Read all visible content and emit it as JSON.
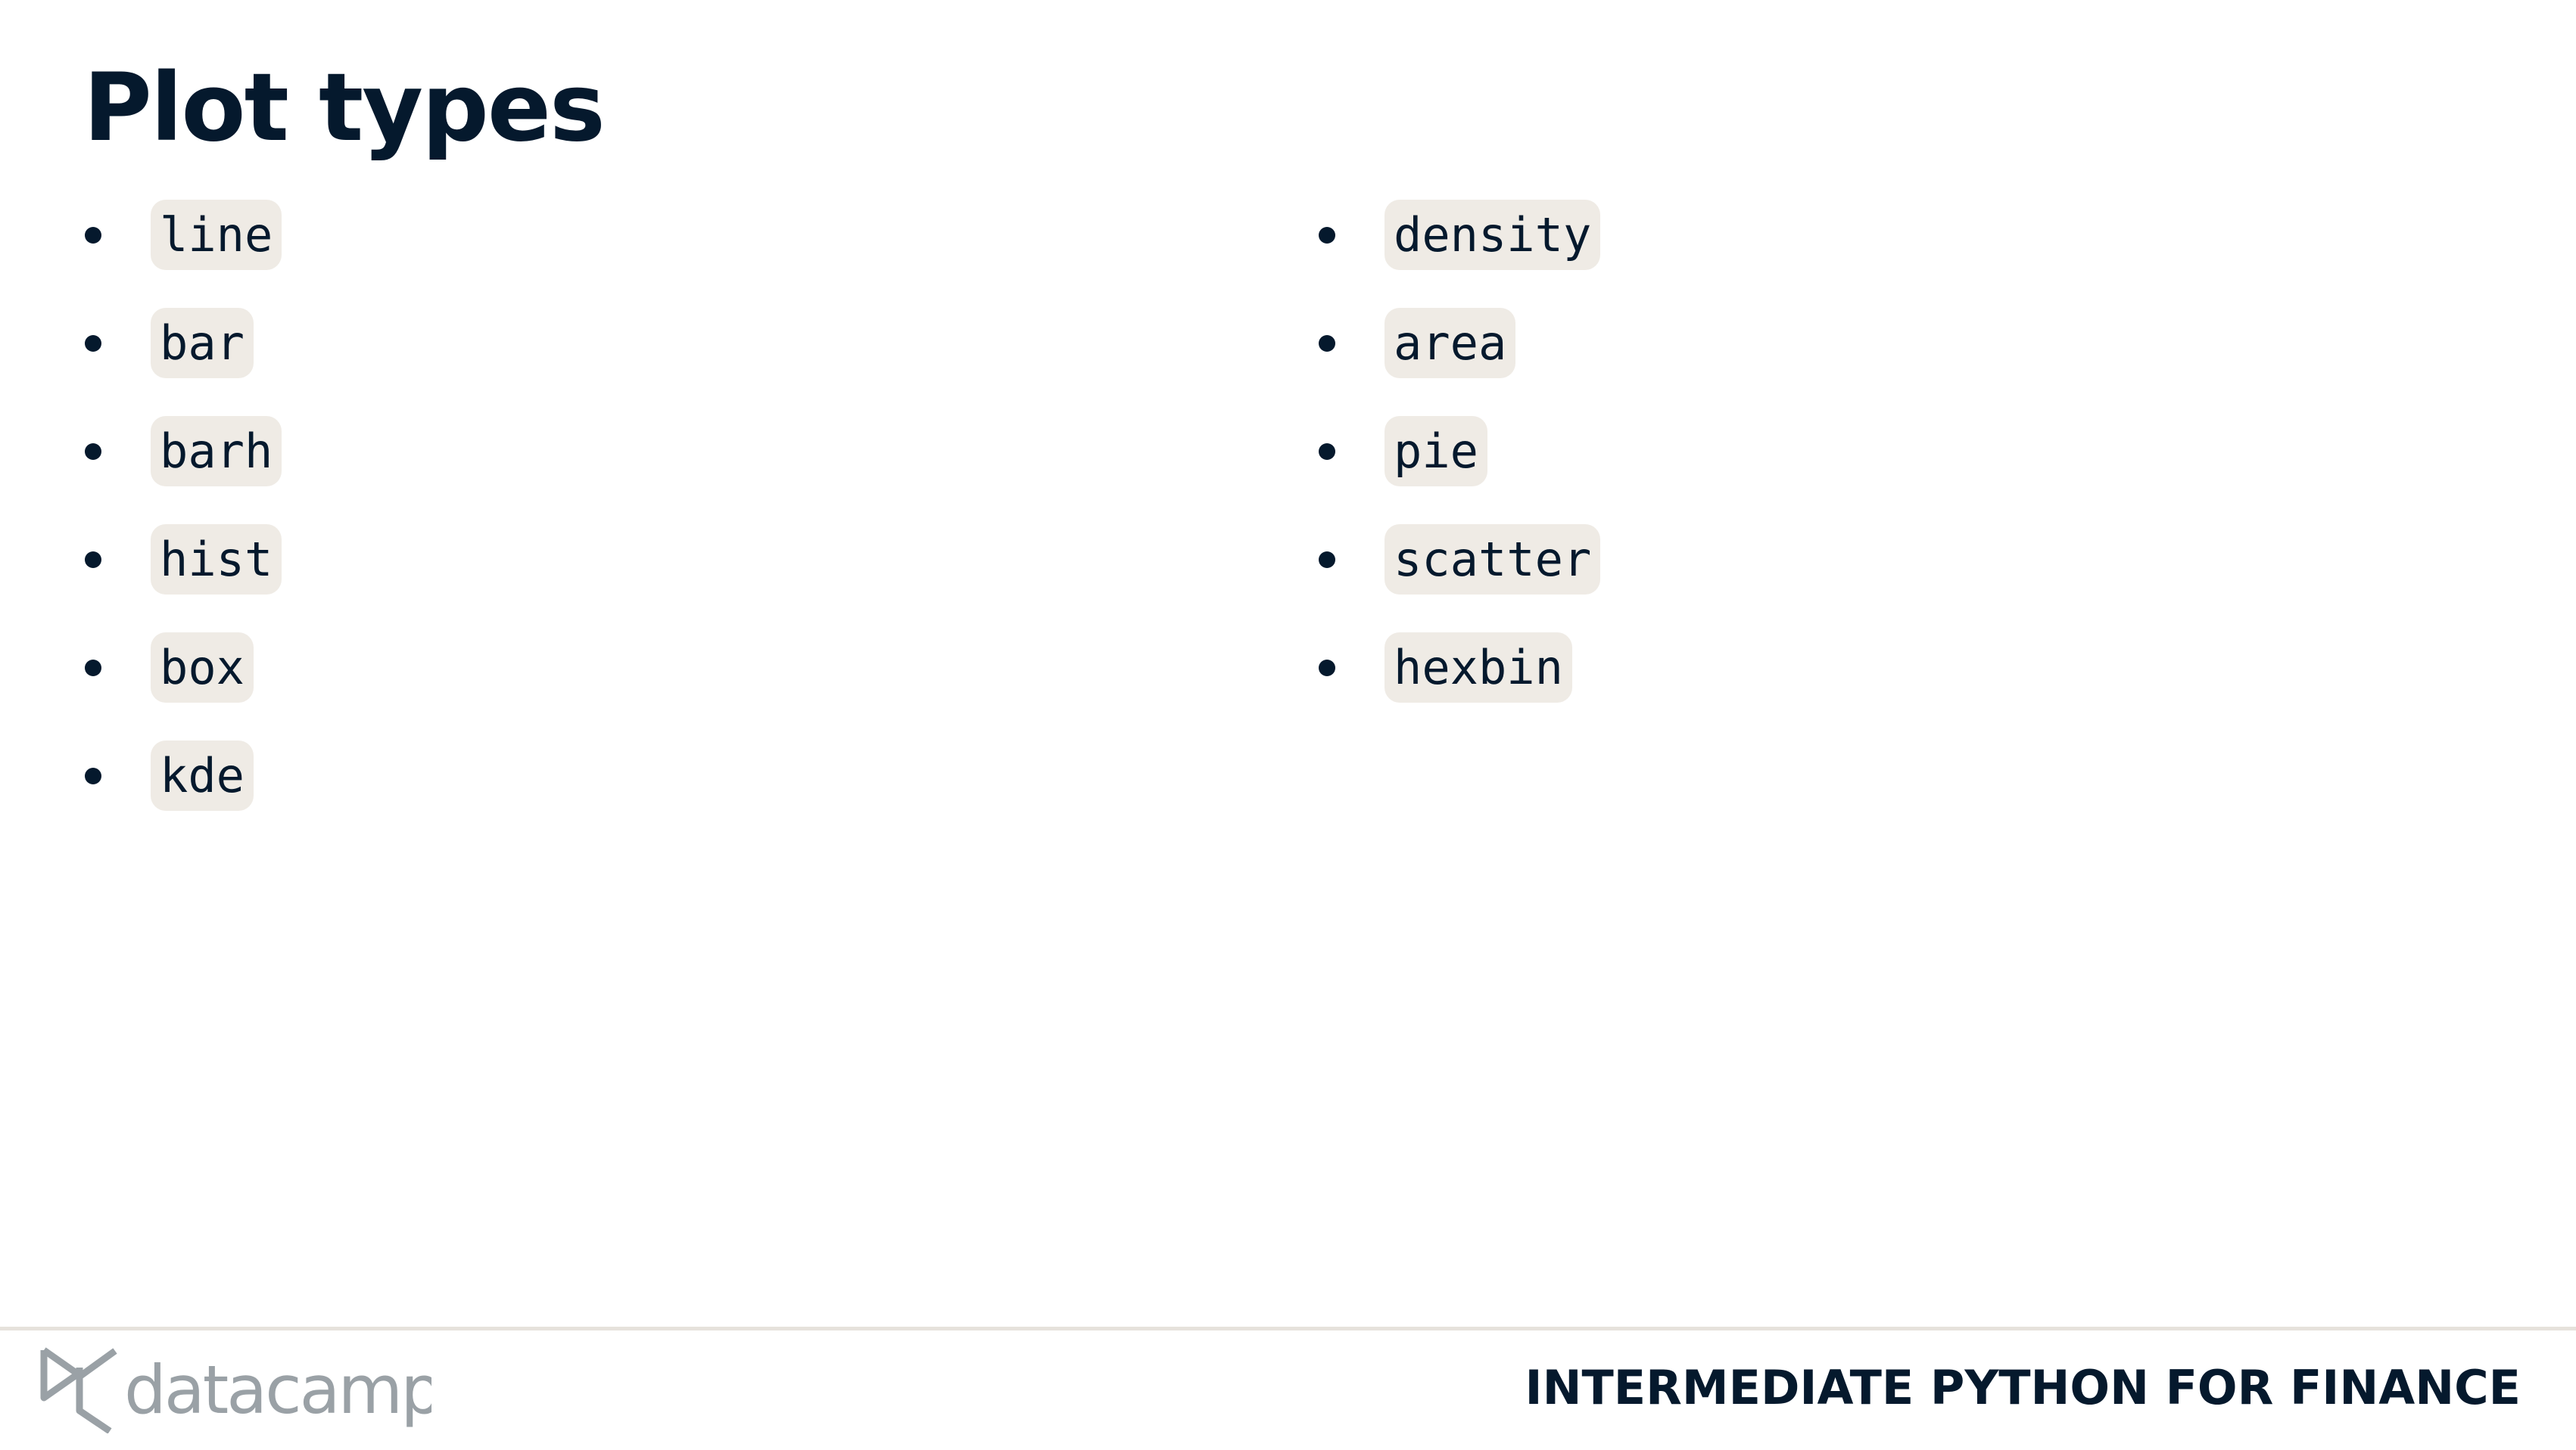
{
  "slide": {
    "title": "Plot types",
    "left_items": [
      "line",
      "bar",
      "barh",
      "hist",
      "box",
      "kde"
    ],
    "right_items": [
      "density",
      "area",
      "pie",
      "scatter",
      "hexbin"
    ]
  },
  "footer": {
    "logo_text": "datacamp",
    "course_title": "INTERMEDIATE PYTHON FOR FINANCE"
  },
  "colors": {
    "text": "#05192d",
    "chip_bg": "#efebe5",
    "logo": "#9aa1a6",
    "divider": "#e6e2dc"
  }
}
